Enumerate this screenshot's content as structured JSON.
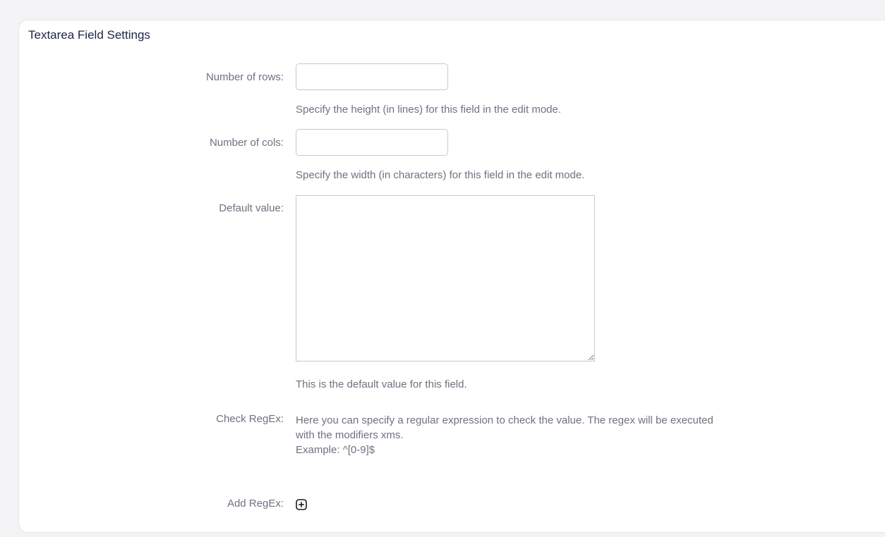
{
  "panel": {
    "title": "Textarea Field Settings"
  },
  "fields": {
    "rows": {
      "label": "Number of rows:",
      "value": "",
      "help": "Specify the height (in lines) for this field in the edit mode."
    },
    "cols": {
      "label": "Number of cols:",
      "value": "",
      "help": "Specify the width (in characters) for this field in the edit mode."
    },
    "default_value": {
      "label": "Default value:",
      "value": "",
      "help": "This is the default value for this field."
    },
    "check_regex": {
      "label": "Check RegEx:",
      "help_line1": "Here you can specify a regular expression to check the value. The regex will be executed",
      "help_line2": "with the modifiers xms.",
      "example": "Example: ^[0-9]$"
    },
    "add_regex": {
      "label": "Add RegEx:",
      "icon": "plus-square-icon"
    }
  },
  "colors": {
    "title": "#1f2447",
    "label": "#6f7180",
    "border": "#c8c8ce",
    "background": "#f3f3f5"
  }
}
